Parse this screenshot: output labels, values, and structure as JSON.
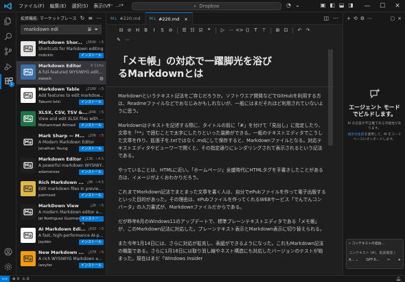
{
  "titlebar": {
    "menu": [
      "ファイル(F)",
      "編集(E)",
      "選択(S)",
      "表示(V)",
      "…"
    ],
    "command_center": "Dropbox",
    "window_controls": [
      "—",
      "☐",
      "✕"
    ]
  },
  "activity": {
    "extensions_badge": "1"
  },
  "sidebar": {
    "title": "拡張機能: マーケットプレース",
    "search_value": "markdown edi",
    "extensions": [
      {
        "name": "Markdown Shor...",
        "downloads": "360K",
        "rating": "5",
        "desc": "Shortcuts for Markdown editing",
        "publisher": "mdickin",
        "action": "インストール",
        "icon": "markdown-shortcuts-icon",
        "icon_bg": "#e8e8e8"
      },
      {
        "name": "Markdown Editor",
        "downloads": "",
        "rating": "",
        "extra": "11ms",
        "desc": "A full-featured WYSIWYG edit...",
        "publisher": "zaaack",
        "action": "gear",
        "icon": "markdown-editor-icon",
        "icon_bg": "#3a6ea5"
      },
      {
        "name": "Markdown Table",
        "downloads": "216K",
        "rating": "5",
        "desc": "Add features to edit markdow...",
        "publisher": "Takumi Ishii",
        "action": "インストール",
        "icon": "markdown-table-icon",
        "icon_bg": "#ffffff"
      },
      {
        "name": "XLSX, CSV, TSV &...",
        "downloads": "84K",
        "rating": "5",
        "desc": "View and edit XLSX files with ...",
        "publisher": "Muhammad Ahmed",
        "action": "インストール",
        "icon": "xlsx-csv-icon",
        "icon_bg": "#1e7145"
      },
      {
        "name": "Mark Sharp — M...",
        "downloads": "20K",
        "rating": "5",
        "desc": "A Modern Markdown Editor",
        "publisher": "Jonathan Yeung",
        "action": "インストール",
        "icon": "mark-sharp-icon",
        "icon_bg": "#1a1a1a"
      },
      {
        "name": "Markdown Editor",
        "downloads": "13K",
        "rating": "4.5",
        "desc": "A powerful markdown WYSIWY...",
        "publisher": "adamerose",
        "action": "インストール",
        "icon": "markdown-editor-blocks-icon",
        "icon_bg": "#1f1f1f"
      },
      {
        "name": "Rich Markdown ...",
        "downloads": "9K",
        "rating": "4.5",
        "desc": "Edit markdown files in previe...",
        "publisher": "patmood",
        "action": "インストール",
        "icon": "rich-markdown-icon",
        "icon_bg": "#e0b94c"
      },
      {
        "name": "MarkDown View",
        "downloads": "2K",
        "rating": "5",
        "desc": "A modern Markdown editor a...",
        "publisher": "Jel Rodriguez Guzman",
        "action": "インストール",
        "icon": "markdown-view-icon",
        "icon_bg": "#1f1f1f"
      },
      {
        "name": "AI Markdown Edi...",
        "downloads": "920",
        "rating": "5",
        "desc": "A fast, high-performance AI-p...",
        "publisher": "Jayden",
        "action": "インストール",
        "icon": "ai-markdown-icon",
        "icon_bg": "#ffffff"
      },
      {
        "name": "New Markdown ...",
        "downloads": "378",
        "rating": "5",
        "desc": "A rich WYSIWYG Markdown e...",
        "publisher": "lwxyfer",
        "action": "インストール",
        "icon": "new-markdown-icon",
        "icon_bg": "#f39c12"
      }
    ]
  },
  "tabs": [
    {
      "label": "#220.md",
      "active": false
    },
    {
      "label": "#220.md",
      "active": true
    }
  ],
  "toolbar": {
    "buttons": [
      "⊟",
      "⊘",
      "H",
      "B",
      "I",
      "S",
      "⊘",
      "|",
      "☰",
      "☷",
      "☑",
      "❝",
      "|",
      "▷",
      "⋯",
      "<>",
      "⟨⟩",
      "T",
      "⊤",
      "|",
      "⊞",
      "⊡",
      "|",
      "↶",
      "↷"
    ]
  },
  "editor": {
    "title": "「メモ帳」の対応で一躍脚光を浴びるMarkdownとは",
    "paragraphs": [
      "Markdownというテキスト記法をご存じだろうか。ソフトウエア開発などでGitHubを利用する方は、Readmeファイルなどでおなじみかもしれないが、一般にはまだそれほど利用されていないように思う。",
      "Markdownはテキストを記述する際に、タイトルの前に「#」を付けて「見出し」に指定したり、文章を「**」で囲むことで太字にしたりといった装飾ができる。一般のテキストエディタでこうした文章を作り、拡張子を.txtではなく.mdにして保存すると、Markdownファイルとなる。対応テキストエディタやビューワーで開くと、その指定通りにレンダリングされて表示されるという記法である。",
      "やっていることは、HTMLに近い。「ホームページ」全盛時代にHTMLタグを手書きしたことがある方は、イメージがよくおわかりだろう。",
      "これまでMarkdown記法でまとまった文章を書く人は、自分でePubファイルを作って電子出版するといった目的があった。その理由は、ePubファイルを作ってくれるWEBサービス「でんでんコンバータ」の入力書式が、Markdownファイルだからである。",
      "だが昨年6月のWindows11のアップデートで、標準プレーンテキストエディタである「メモ帳」が、このMarkdown記法に対応した。プレーンテキスト表示とMarkdown表示に切り替えられる。",
      "また今年1月14日には、さらに対応が拡充し、表組ができるようになった。これもMarkdown記法の機能である。さらに1月16日には取り消し線やネスト構造にも対応したバージョンのテストが始まった。現在はまだ「Windows Insider"
    ]
  },
  "panel": {
    "title_line1": "エージェント モード",
    "title_line2": "でビルドします。",
    "sub": "AI の応答が不正確である可能性があります。",
    "link": "指示の生成",
    "sub2": "を使用して、AI をコードベースにオンボードします。",
    "chat_context": "コンテキストの追加...",
    "chat_placeholder": "コンテキスト (#)、拡張機能 (",
    "chat_model": "GPT-5...",
    "chat_mode": "A..."
  },
  "status": {
    "errors": "0",
    "warnings": "0"
  }
}
